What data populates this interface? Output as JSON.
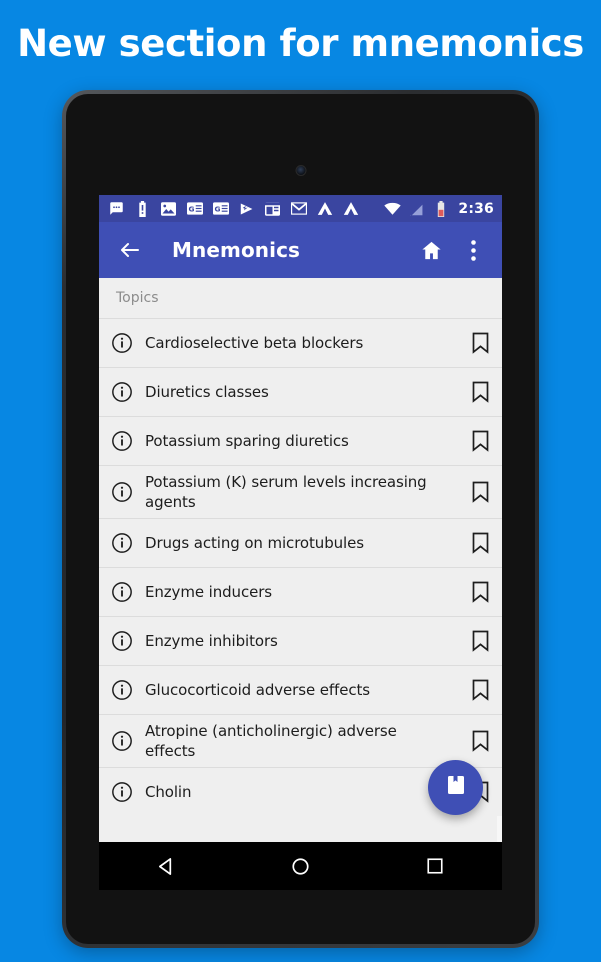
{
  "promo": {
    "headline": "New section for mnemonics",
    "background_color": "#0787E3",
    "headline_color": "#FFFFFF"
  },
  "device": {
    "type": "android-tablet",
    "frame_color": "#2b2d30",
    "camera": "front-camera-dot",
    "led": "notification-led-dot"
  },
  "status_bar": {
    "background_color": "#3A45A0",
    "time": "2:36",
    "left_icons": [
      "messages-icon",
      "battery-alert-icon",
      "photo-icon",
      "google-news-icon",
      "google-news-icon-2",
      "play-icon",
      "calendar-icon",
      "gmail-icon",
      "app-triangle-icon",
      "app-triangle-icon-2"
    ],
    "right_icons": [
      "wifi-icon",
      "no-signal-icon",
      "battery-icon"
    ]
  },
  "app_bar": {
    "background_color": "#3F4FB5",
    "title": "Mnemonics",
    "back_icon": "back-arrow-icon",
    "home_icon": "home-icon",
    "overflow_icon": "overflow-menu-icon"
  },
  "content": {
    "section_header": "Topics",
    "list_background": "#EFEFEF",
    "items": [
      {
        "label": "Cardioselective beta blockers",
        "info_icon": "info-icon",
        "bookmark_icon": "bookmark-outline-icon"
      },
      {
        "label": "Diuretics classes",
        "info_icon": "info-icon",
        "bookmark_icon": "bookmark-outline-icon"
      },
      {
        "label": "Potassium sparing diuretics",
        "info_icon": "info-icon",
        "bookmark_icon": "bookmark-outline-icon"
      },
      {
        "label": "Potassium (K) serum levels increasing agents",
        "info_icon": "info-icon",
        "bookmark_icon": "bookmark-outline-icon"
      },
      {
        "label": "Drugs acting on microtubules",
        "info_icon": "info-icon",
        "bookmark_icon": "bookmark-outline-icon"
      },
      {
        "label": "Enzyme inducers",
        "info_icon": "info-icon",
        "bookmark_icon": "bookmark-outline-icon"
      },
      {
        "label": "Enzyme inhibitors",
        "info_icon": "info-icon",
        "bookmark_icon": "bookmark-outline-icon"
      },
      {
        "label": "Glucocorticoid adverse effects",
        "info_icon": "info-icon",
        "bookmark_icon": "bookmark-outline-icon"
      },
      {
        "label": "Atropine (anticholinergic) adverse effects",
        "info_icon": "info-icon",
        "bookmark_icon": "bookmark-outline-icon"
      },
      {
        "label": "Cholin",
        "info_icon": "info-icon",
        "bookmark_icon": "bookmark-outline-icon"
      }
    ]
  },
  "fab": {
    "icon": "bookmarks-book-icon",
    "color": "#3F4FB5"
  },
  "nav_bar": {
    "background_color": "#000000",
    "back": "nav-back-triangle-icon",
    "home": "nav-home-circle-icon",
    "recents": "nav-recents-square-icon"
  }
}
